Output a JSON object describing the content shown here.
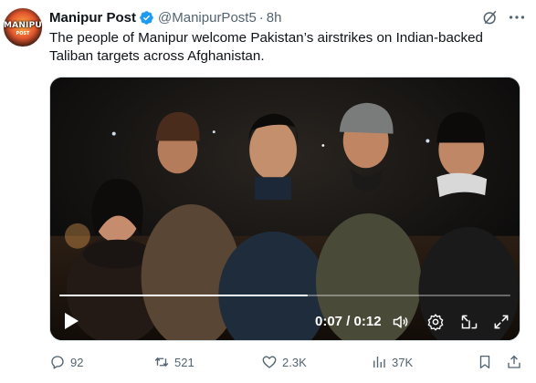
{
  "account": {
    "display_name": "Manipur Post",
    "handle": "@ManipurPost5",
    "separator": "·",
    "time": "8h",
    "avatar_logo_text": "MANIPUR",
    "avatar_sub_text": "POST"
  },
  "tweet": {
    "text": "The people of Manipur welcome Pakistan’s airstrikes on Indian-backed Taliban targets across Afghanistan."
  },
  "video": {
    "time_readout": "0:07 / 0:12",
    "progress": 0.55
  },
  "actions": {
    "replies": "92",
    "reposts": "521",
    "likes": "2.3K",
    "views": "37K"
  },
  "colors": {
    "verified": "#1d9bf0",
    "muted": "#536471",
    "text": "#0f1419"
  },
  "icons": [
    "verified-badge-icon",
    "grok-icon",
    "more-icon",
    "play-icon",
    "volume-icon",
    "settings-icon",
    "picture-in-picture-icon",
    "fullscreen-icon",
    "reply-icon",
    "repost-icon",
    "like-icon",
    "views-icon",
    "bookmark-icon",
    "share-icon"
  ]
}
